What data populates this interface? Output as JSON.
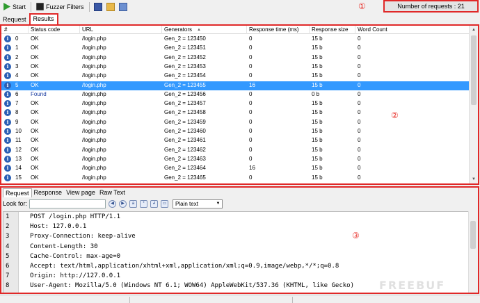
{
  "toolbar": {
    "start_label": "Start",
    "fuzzer_filters_label": "Fuzzer Filters",
    "request_count": "Number of requests : 21",
    "accent_color": "#e02828"
  },
  "annotations": {
    "a1": "①",
    "a2": "②",
    "a3": "③"
  },
  "tabs": {
    "request": "Request",
    "results": "Results"
  },
  "results": {
    "columns": [
      "#",
      "Status code",
      "URL",
      "Generators",
      "Response time (ms)",
      "Response size",
      "Word Count"
    ],
    "sort_indicator": "▲",
    "rows": [
      {
        "num": "0",
        "status": "OK",
        "url": "/login.php",
        "gen": "Gen_2 = 123450",
        "time": "0",
        "size": "15 b",
        "words": "0"
      },
      {
        "num": "1",
        "status": "OK",
        "url": "/login.php",
        "gen": "Gen_2 = 123451",
        "time": "0",
        "size": "15 b",
        "words": "0"
      },
      {
        "num": "2",
        "status": "OK",
        "url": "/login.php",
        "gen": "Gen_2 = 123452",
        "time": "0",
        "size": "15 b",
        "words": "0"
      },
      {
        "num": "3",
        "status": "OK",
        "url": "/login.php",
        "gen": "Gen_2 = 123453",
        "time": "0",
        "size": "15 b",
        "words": "0"
      },
      {
        "num": "4",
        "status": "OK",
        "url": "/login.php",
        "gen": "Gen_2 = 123454",
        "time": "0",
        "size": "15 b",
        "words": "0"
      },
      {
        "num": "5",
        "status": "OK",
        "url": "/login.php",
        "gen": "Gen_2 = 123455",
        "time": "16",
        "size": "15 b",
        "words": "0"
      },
      {
        "num": "6",
        "status": "Found",
        "url": "/login.php",
        "gen": "Gen_2 = 123456",
        "time": "0",
        "size": "0 b",
        "words": "0"
      },
      {
        "num": "7",
        "status": "OK",
        "url": "/login.php",
        "gen": "Gen_2 = 123457",
        "time": "0",
        "size": "15 b",
        "words": "0"
      },
      {
        "num": "8",
        "status": "OK",
        "url": "/login.php",
        "gen": "Gen_2 = 123458",
        "time": "0",
        "size": "15 b",
        "words": "0"
      },
      {
        "num": "9",
        "status": "OK",
        "url": "/login.php",
        "gen": "Gen_2 = 123459",
        "time": "0",
        "size": "15 b",
        "words": "0"
      },
      {
        "num": "10",
        "status": "OK",
        "url": "/login.php",
        "gen": "Gen_2 = 123460",
        "time": "0",
        "size": "15 b",
        "words": "0"
      },
      {
        "num": "11",
        "status": "OK",
        "url": "/login.php",
        "gen": "Gen_2 = 123461",
        "time": "0",
        "size": "15 b",
        "words": "0"
      },
      {
        "num": "12",
        "status": "OK",
        "url": "/login.php",
        "gen": "Gen_2 = 123462",
        "time": "0",
        "size": "15 b",
        "words": "0"
      },
      {
        "num": "13",
        "status": "OK",
        "url": "/login.php",
        "gen": "Gen_2 = 123463",
        "time": "0",
        "size": "15 b",
        "words": "0"
      },
      {
        "num": "14",
        "status": "OK",
        "url": "/login.php",
        "gen": "Gen_2 = 123464",
        "time": "16",
        "size": "15 b",
        "words": "0"
      },
      {
        "num": "15",
        "status": "OK",
        "url": "/login.php",
        "gen": "Gen_2 = 123465",
        "time": "0",
        "size": "15 b",
        "words": "0"
      }
    ],
    "selected_row": "5",
    "selection_color": "#3399ff"
  },
  "detail": {
    "tabs": [
      "Request",
      "Response",
      "View page",
      "Raw Text"
    ],
    "look_for_label": "Look for:",
    "look_for_value": "",
    "format_option": "Plain text",
    "lines": [
      {
        "n": "1",
        "text": "POST /login.php HTTP/1.1"
      },
      {
        "n": "2",
        "text": "Host: 127.0.0.1"
      },
      {
        "n": "3",
        "text": "Proxy-Connection: keep-alive"
      },
      {
        "n": "4",
        "text": "Content-Length: 30"
      },
      {
        "n": "5",
        "text": "Cache-Control: max-age=0"
      },
      {
        "n": "6",
        "text": "Accept: text/html,application/xhtml+xml,application/xml;q=0.9,image/webp,*/*;q=0.8"
      },
      {
        "n": "7",
        "text": "Origin: http://127.0.0.1"
      },
      {
        "n": "8",
        "text": "User-Agent: Mozilla/5.0 (Windows NT 6.1; WOW64) AppleWebKit/537.36 (KHTML, like Gecko)"
      }
    ]
  },
  "watermark": "FREEBUF"
}
